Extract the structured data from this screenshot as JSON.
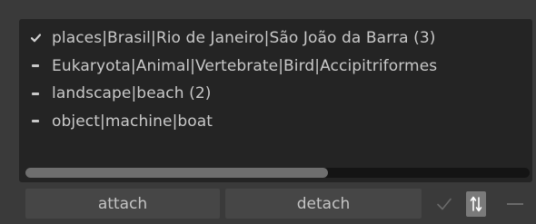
{
  "tags": [
    {
      "state": "check",
      "label": "places|Brasil|Rio de Janeiro|São João da Barra (3)"
    },
    {
      "state": "dash",
      "label": "Eukaryota|Animal|Vertebrate|Bird|Accipitriformes"
    },
    {
      "state": "dash",
      "label": "landscape|beach (2)"
    },
    {
      "state": "dash",
      "label": "object|machine|boat"
    }
  ],
  "scroll": {
    "position": 0,
    "visible_fraction": 0.6
  },
  "buttons": {
    "attach_label": "attach",
    "detach_label": "detach"
  },
  "toolbar": {
    "icons": [
      "checkmark-icon",
      "sort-icon",
      "minus-icon"
    ]
  },
  "colors": {
    "background": "#3a3a3a",
    "list_background": "#242424",
    "button_background": "#464646",
    "text": "#c9c9c9",
    "sort_toggle_active": "#7a7a7a"
  }
}
